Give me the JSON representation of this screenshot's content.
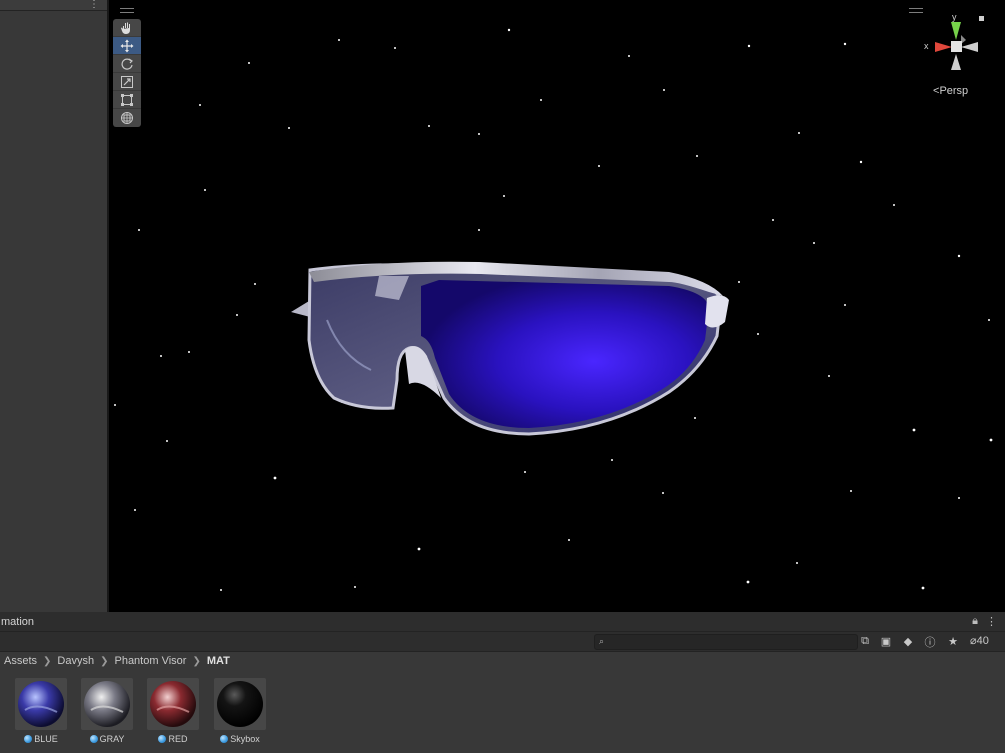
{
  "scene_view": {
    "projection_label": "Persp",
    "gizmo": {
      "x_label": "x",
      "y_label": "y"
    },
    "tools": [
      "hand-tool",
      "move-tool",
      "rotate-tool",
      "scale-tool",
      "rect-tool",
      "transform-tool"
    ],
    "active_tool": "move-tool"
  },
  "project_panel": {
    "tab_title": "mation",
    "search": {
      "value": "",
      "placeholder": ""
    },
    "hidden_count": "40",
    "breadcrumb": [
      "Assets",
      "Davysh",
      "Phantom Visor",
      "MAT"
    ],
    "assets": [
      {
        "label": "BLUE",
        "type": "material"
      },
      {
        "label": "GRAY",
        "type": "material"
      },
      {
        "label": "RED",
        "type": "material"
      },
      {
        "label": "Skybox",
        "type": "material"
      }
    ]
  },
  "colors": {
    "editor_bg": "#383838",
    "scene_bg": "#000000",
    "active_tool": "#3c5a84",
    "lens_blue": "#2b14c8",
    "gizmo_x": "#e0483c",
    "gizmo_y": "#76d24a"
  }
}
